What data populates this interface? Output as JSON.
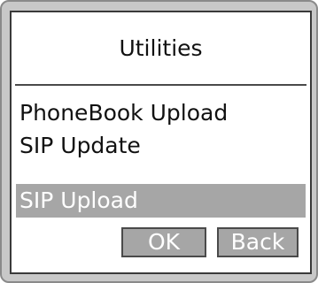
{
  "window": {
    "title": "Utilities"
  },
  "menu": {
    "items": [
      {
        "label": "PhoneBook Upload",
        "selected": false
      },
      {
        "label": "SIP Update",
        "selected": false
      },
      {
        "label": "SIP Upload",
        "selected": true
      }
    ]
  },
  "buttons": {
    "ok_label": "OK",
    "back_label": "Back"
  },
  "colors": {
    "selection": "#a6a6a6",
    "frame": "#c8c8c8",
    "screen": "#ffffff"
  }
}
